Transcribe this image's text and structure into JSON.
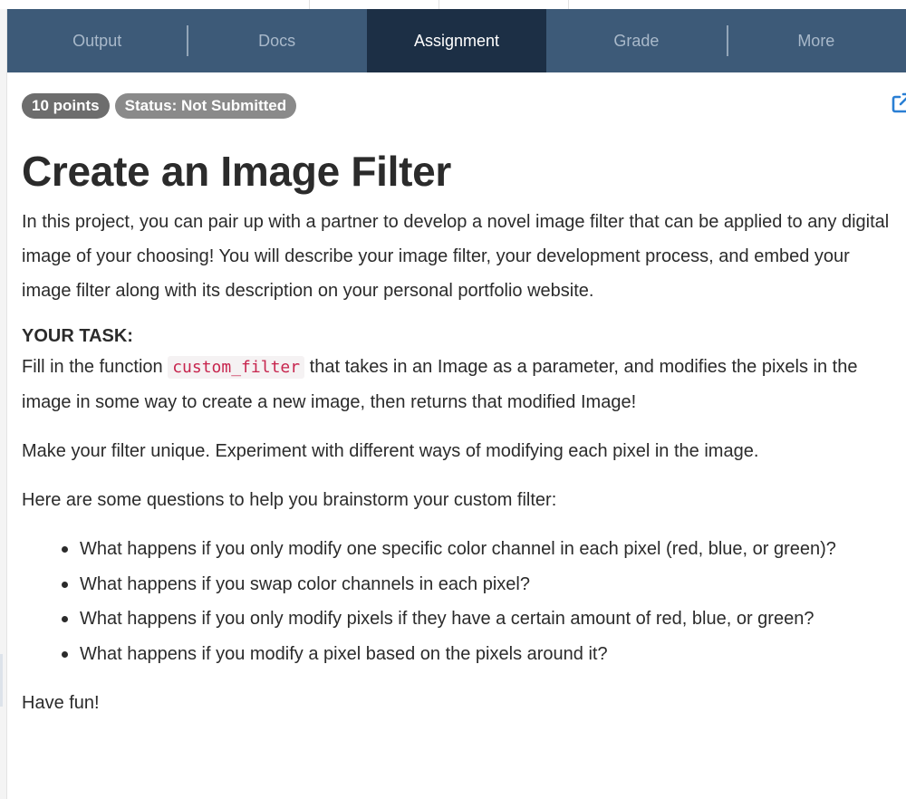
{
  "tabs": [
    {
      "label": "Output",
      "active": false
    },
    {
      "label": "Docs",
      "active": false
    },
    {
      "label": "Assignment",
      "active": true
    },
    {
      "label": "Grade",
      "active": false
    },
    {
      "label": "More",
      "active": false
    }
  ],
  "badges": {
    "points": "10 points",
    "status": "Status: Not Submitted"
  },
  "icons": {
    "external_link": "external-link-icon"
  },
  "colors": {
    "tab_bar": "#3d5a78",
    "tab_active": "#1c2f45",
    "link_icon": "#2a7fd4",
    "code_text": "#c7254e"
  },
  "assignment": {
    "title": "Create an Image Filter",
    "intro": "In this project, you can pair up with a partner to develop a novel image filter that can be applied to any digital image of your choosing! You will describe your image filter, your development process, and embed your image filter along with its description on your personal portfolio website.",
    "task_heading": "YOUR TASK:",
    "task_before": "Fill in the function ",
    "task_code": "custom_filter",
    "task_after": " that takes in an Image as a parameter, and modifies the pixels in the image in some way to create a new image, then returns that modified Image!",
    "unique": "Make your filter unique. Experiment with different ways of modifying each pixel in the image.",
    "questions_intro": "Here are some questions to help you brainstorm your custom filter:",
    "questions": [
      "What happens if you only modify one specific color channel in each pixel (red, blue, or green)?",
      "What happens if you swap color channels in each pixel?",
      "What happens if you only modify pixels if they have a certain amount of red, blue, or green?",
      "What happens if you modify a pixel based on the pixels around it?"
    ],
    "closing": "Have fun!"
  }
}
